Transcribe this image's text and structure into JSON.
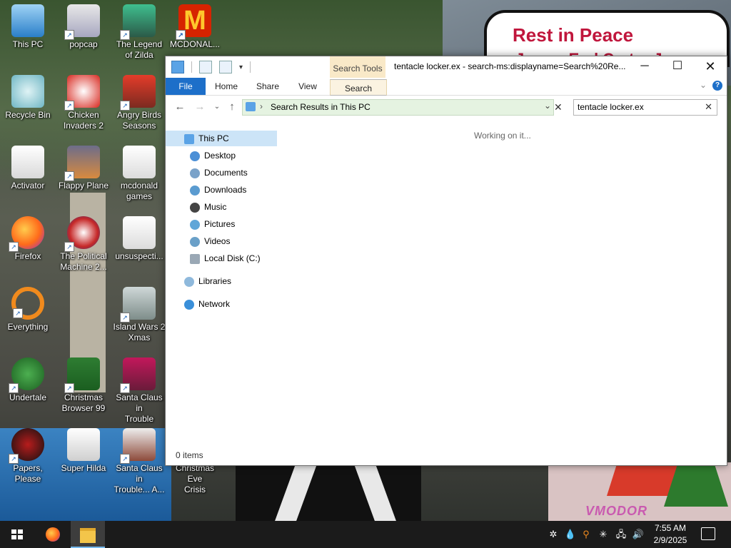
{
  "desktop": {
    "wallpaper_sign": [
      "Rest in Peace",
      "James Earl Carter Jr."
    ],
    "wallpaper_watermark": "VMODOR",
    "icons": [
      {
        "label": "This PC"
      },
      {
        "label": "popcap"
      },
      {
        "label": "The Legend\nof Zilda"
      },
      {
        "label": "MCDONAL..."
      },
      {
        "label": "Recycle Bin"
      },
      {
        "label": "Chicken\nInvaders 2"
      },
      {
        "label": "Angry Birds\nSeasons"
      },
      {
        "label": "Activator"
      },
      {
        "label": "Flappy Plane"
      },
      {
        "label": "mcdonald\ngames"
      },
      {
        "label": "Firefox"
      },
      {
        "label": "The Political\nMachine 2..."
      },
      {
        "label": "unsuspecti..."
      },
      {
        "label": "Everything"
      },
      {
        "label": "Island Wars 2\nXmas"
      },
      {
        "label": "Undertale"
      },
      {
        "label": "Christmas\nBrowser 99"
      },
      {
        "label": "Santa Claus in\nTrouble"
      },
      {
        "label": "Papers, Please"
      },
      {
        "label": "Super Hilda"
      },
      {
        "label": "Santa Claus in\nTrouble... A..."
      },
      {
        "label": "Christmas Eve\nCrisis"
      }
    ]
  },
  "explorer": {
    "title": "tentacle locker.ex - search-ms:displayname=Search%20Re...",
    "context_tab": "Search Tools",
    "ribbon_tabs": [
      "File",
      "Home",
      "Share",
      "View",
      "Search"
    ],
    "address": "Search Results in This PC",
    "search_value": "tentacle locker.ex",
    "status": "Working on it...",
    "item_count": "0 items",
    "nav": [
      "This PC",
      "Desktop",
      "Documents",
      "Downloads",
      "Music",
      "Pictures",
      "Videos",
      "Local Disk (C:)",
      "Libraries",
      "Network"
    ]
  },
  "taskbar": {
    "time": "7:55 AM",
    "date": "2/9/2025",
    "apps": [
      "firefox-icon",
      "file-explorer-icon"
    ]
  }
}
